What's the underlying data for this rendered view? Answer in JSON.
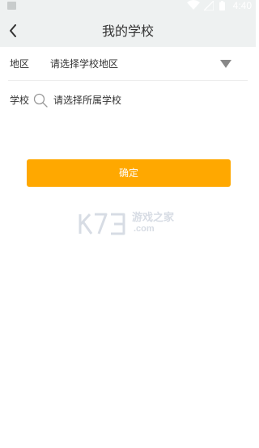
{
  "status_bar": {
    "time": "4:40",
    "icons": [
      "photo-icon",
      "wifi-icon",
      "signal-icon",
      "battery-icon"
    ]
  },
  "header": {
    "title": "我的学校",
    "back_icon": "chevron-left-icon"
  },
  "form": {
    "region": {
      "label": "地区",
      "value": "请选择学校地区",
      "icon": "triangle-down-icon"
    },
    "school": {
      "label": "学校",
      "icon": "search-icon",
      "placeholder": "请选择所属学校",
      "value": ""
    }
  },
  "confirm_button": {
    "label": "确定"
  },
  "watermark": {
    "logo": "K73",
    "text": "游戏之家",
    "domain": ".com"
  },
  "colors": {
    "header_bg": "#eef1f1",
    "accent": "#ffa800",
    "text": "#333333",
    "divider": "#ededed",
    "watermark": "#d7dce4"
  }
}
